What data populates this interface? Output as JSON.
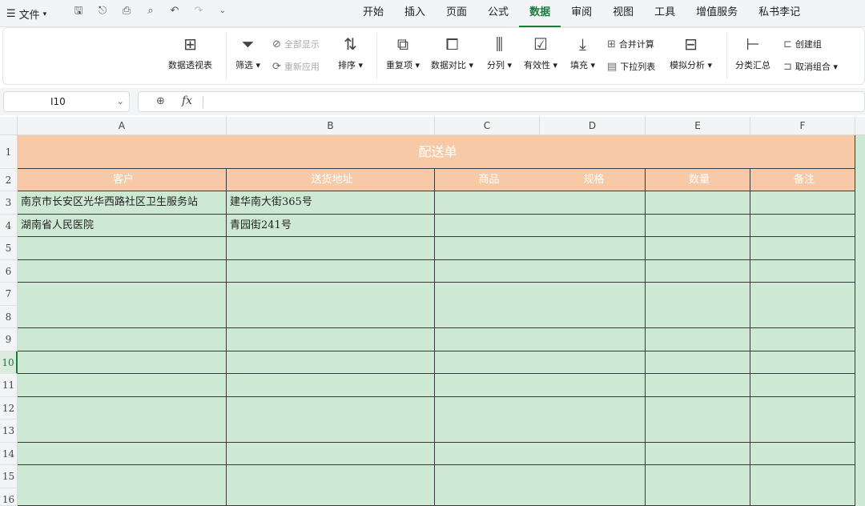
{
  "app": {
    "file_label": "文件"
  },
  "menu_tabs": [
    {
      "label": "开始",
      "active": false
    },
    {
      "label": "插入",
      "active": false
    },
    {
      "label": "页面",
      "active": false
    },
    {
      "label": "公式",
      "active": false
    },
    {
      "label": "数据",
      "active": true
    },
    {
      "label": "审阅",
      "active": false
    },
    {
      "label": "视图",
      "active": false
    },
    {
      "label": "工具",
      "active": false
    },
    {
      "label": "增值服务",
      "active": false
    },
    {
      "label": "私书李记",
      "active": false
    }
  ],
  "ribbon": {
    "pivot": "数据透视表",
    "filter": "筛选",
    "show_all": "全部显示",
    "reapply": "重新应用",
    "sort": "排序",
    "duplicates": "重复项",
    "compare": "数据对比",
    "split": "分列",
    "validity": "有效性",
    "fill": "填充",
    "consolidate": "合并计算",
    "dropdown_list": "下拉列表",
    "what_if": "模拟分析",
    "subtotal": "分类汇总",
    "create_group": "创建组",
    "ungroup": "取消组合"
  },
  "formula_bar": {
    "cell_ref": "I10",
    "fx": "fx",
    "value": ""
  },
  "columns": [
    "A",
    "B",
    "C",
    "D",
    "E",
    "F"
  ],
  "rows": [
    "1",
    "2",
    "3",
    "4",
    "5",
    "6",
    "7",
    "8",
    "9",
    "10",
    "11",
    "12",
    "13",
    "14",
    "15",
    "16"
  ],
  "selected_row": "10",
  "sheet": {
    "title": "配送单",
    "headers": {
      "customer": "客户",
      "address": "送货地址",
      "product": "商品",
      "spec": "规格",
      "qty": "数量",
      "note": "备注"
    },
    "data": [
      {
        "customer": "南京市长安区光华西路社区卫生服务站",
        "address": "建华南大街365号"
      },
      {
        "customer": "湖南省人民医院",
        "address": "青园街241号"
      }
    ]
  }
}
